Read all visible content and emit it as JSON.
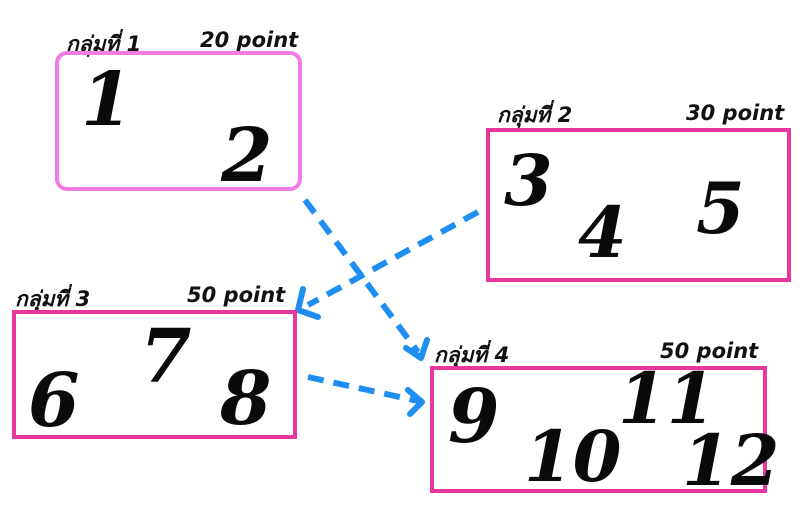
{
  "colors": {
    "group1_border": "#f07ce6",
    "group_border": "#e8369f",
    "arrow": "#1e8ff0"
  },
  "groups": [
    {
      "name": "กลุ่มที่ 1",
      "points": "20 point",
      "numbers": [
        "1",
        "2"
      ]
    },
    {
      "name": "กลุ่มที่ 2",
      "points": "30 point",
      "numbers": [
        "3",
        "4",
        "5"
      ]
    },
    {
      "name": "กลุ่มที่ 3",
      "points": "50 point",
      "numbers": [
        "6",
        "7",
        "8"
      ]
    },
    {
      "name": "กลุ่มที่ 4",
      "points": "50 point",
      "numbers": [
        "9",
        "10",
        "11",
        "12"
      ]
    }
  ],
  "arrows": [
    {
      "from": "กลุ่มที่ 1",
      "to": "กลุ่มที่ 4"
    },
    {
      "from": "กลุ่มที่ 2",
      "to": "กลุ่มที่ 3"
    },
    {
      "from": "กลุ่มที่ 3",
      "to": "กลุ่มที่ 4"
    }
  ]
}
